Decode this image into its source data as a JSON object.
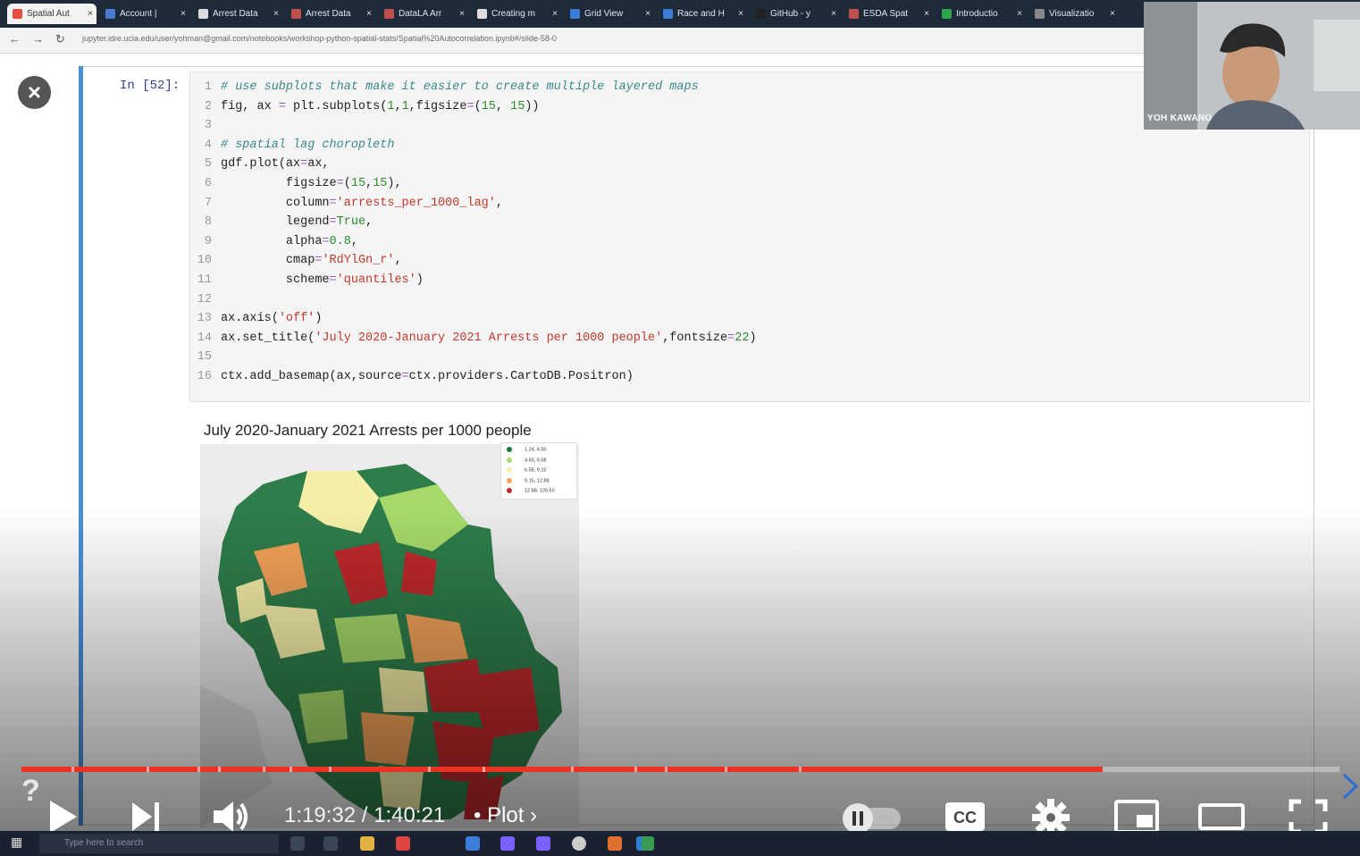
{
  "browser": {
    "tabs": [
      {
        "label": "Spatial Aut",
        "active": true,
        "color": "#e74c3c"
      },
      {
        "label": "Account | ",
        "color": "#4a7bd4"
      },
      {
        "label": "Arrest Data",
        "color": "#dddddd"
      },
      {
        "label": "Arrest Data",
        "color": "#c0504d"
      },
      {
        "label": "DataLA Arr",
        "color": "#c0504d"
      },
      {
        "label": "Creating m",
        "color": "#dddddd"
      },
      {
        "label": "Grid View",
        "color": "#3b7dd8"
      },
      {
        "label": "Race and H",
        "color": "#3b7dd8"
      },
      {
        "label": "GitHub - y",
        "color": "#222222"
      },
      {
        "label": "ESDA Spat",
        "color": "#c0504d"
      },
      {
        "label": "Introductio",
        "color": "#2ea44f"
      },
      {
        "label": "Visualizatio",
        "color": "#888888"
      }
    ],
    "tab_close": "×",
    "url": "jupyter.idre.ucla.edu/user/yohman@gmail.com/notebooks/workshop-python-spatial-stats/Spatial%20Autocorrelation.ipynb#/slide-58-0"
  },
  "notebook": {
    "prompt": "In [52]:",
    "code_lines": [
      {
        "n": "1",
        "html": "<span class='cm'># use subplots that make it easier to create multiple layered maps</span>"
      },
      {
        "n": "2",
        "html": "fig, ax <span class='op'>=</span> plt.subplots(<span class='nm'>1</span>,<span class='nm'>1</span>,figsize<span class='op'>=</span>(<span class='nm'>15</span>, <span class='nm'>15</span>))"
      },
      {
        "n": "3",
        "html": ""
      },
      {
        "n": "4",
        "html": "<span class='cm'># spatial lag choropleth</span>"
      },
      {
        "n": "5",
        "html": "gdf.plot(ax<span class='op'>=</span>ax,"
      },
      {
        "n": "6",
        "html": "         figsize<span class='op'>=</span>(<span class='nm'>15</span>,<span class='nm'>15</span>),"
      },
      {
        "n": "7",
        "html": "         column<span class='op'>=</span><span class='st'>'arrests_per_1000_lag'</span>,"
      },
      {
        "n": "8",
        "html": "         legend<span class='op'>=</span><span class='kw'>True</span>,"
      },
      {
        "n": "9",
        "html": "         alpha<span class='op'>=</span><span class='nm'>0.8</span>,"
      },
      {
        "n": "10",
        "html": "         cmap<span class='op'>=</span><span class='st'>'RdYlGn_r'</span>,"
      },
      {
        "n": "11",
        "html": "         scheme<span class='op'>=</span><span class='st'>'quantiles'</span>)"
      },
      {
        "n": "12",
        "html": ""
      },
      {
        "n": "13",
        "html": "ax.axis(<span class='st'>'off'</span>)"
      },
      {
        "n": "14",
        "html": "ax.set_title(<span class='st'>'July 2020-January 2021 Arrests per 1000 people'</span>,fontsize<span class='op'>=</span><span class='nm'>22</span>)"
      },
      {
        "n": "15",
        "html": ""
      },
      {
        "n": "16",
        "html": "ctx.add_basemap(ax,source<span class='op'>=</span>ctx.providers.CartoDB.Positron)"
      }
    ],
    "output_title": "July 2020-January 2021 Arrests per 1000 people",
    "legend": [
      {
        "label": "1.24,  4.50",
        "color": "#1a7a3a"
      },
      {
        "label": "4.50,  6.58",
        "color": "#a6d96a"
      },
      {
        "label": "6.58,  9.15",
        "color": "#f5f0b0"
      },
      {
        "label": "9.15,  12.88",
        "color": "#f4a259"
      },
      {
        "label": "12.88, 126.60",
        "color": "#c0282b"
      }
    ]
  },
  "webcam": {
    "name": "YOH KAWANO"
  },
  "player": {
    "time_current": "1:19:32",
    "time_sep": " / ",
    "time_total": "1:40:21",
    "bullet": "•",
    "chapter": "Plot",
    "played_fraction": 0.82,
    "cc_label": "CC",
    "help": "?",
    "accent": "#ea3323"
  },
  "taskbar": {
    "search_placeholder": "Type here to search"
  }
}
